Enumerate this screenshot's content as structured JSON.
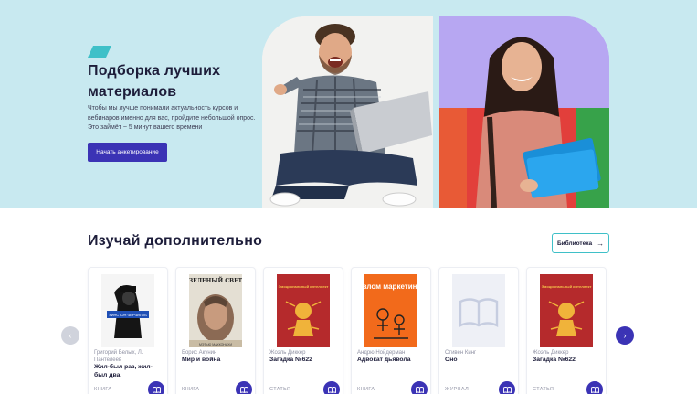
{
  "hero": {
    "title": "Подборка лучших материалов",
    "description": "Чтобы мы лучше понимали актуальность курсов и вебинаров именно для вас, пройдите небольшой опрос. Это займёт ~ 5 минут вашего времени",
    "button_label": "Начать анкетирование"
  },
  "section": {
    "title": "Изучай дополнительно",
    "library_button": "Библиотека",
    "library_arrow": "→",
    "prev_icon": "‹",
    "next_icon": "›"
  },
  "cards": [
    {
      "author": "Григорий Белых, Л. Пантелеев",
      "title": "Жил-был раз, жил-был два",
      "type": "КНИГА",
      "cover": "churchill-book"
    },
    {
      "author": "Борис Акунин",
      "title": "Мир и война",
      "type": "КНИГА",
      "cover": "green-light-book"
    },
    {
      "author": "Жоэль Диккер",
      "title": "Загадка №622",
      "type": "СТАТЬЯ",
      "cover": "red-book"
    },
    {
      "author": "Андрю Нойдерман",
      "title": "Адвокат дьявола",
      "type": "КНИГА",
      "cover": "orange-marketing-book"
    },
    {
      "author": "Стивен Кинг",
      "title": "Оно",
      "type": "ЖУРНАЛ",
      "cover": "placeholder-book"
    },
    {
      "author": "Жоэль Диккер",
      "title": "Загадка №622",
      "type": "СТАТЬЯ",
      "cover": "red-book"
    }
  ],
  "covers": {
    "churchill_top": "УИНСТОН ЧЕРЧИЛЛЬ",
    "green_light": "ЗЕЛЕНЫЙ СВЕТ",
    "green_light_author": "МЭТЬЮ МАККОНАХИ",
    "red_book_title": "Эмоциональный интеллект",
    "marketing_title": "Взлом маркетинга"
  },
  "colors": {
    "accent": "#3b33b5",
    "hero_bg": "#c8e9f0",
    "teal": "#3fc0c8"
  }
}
